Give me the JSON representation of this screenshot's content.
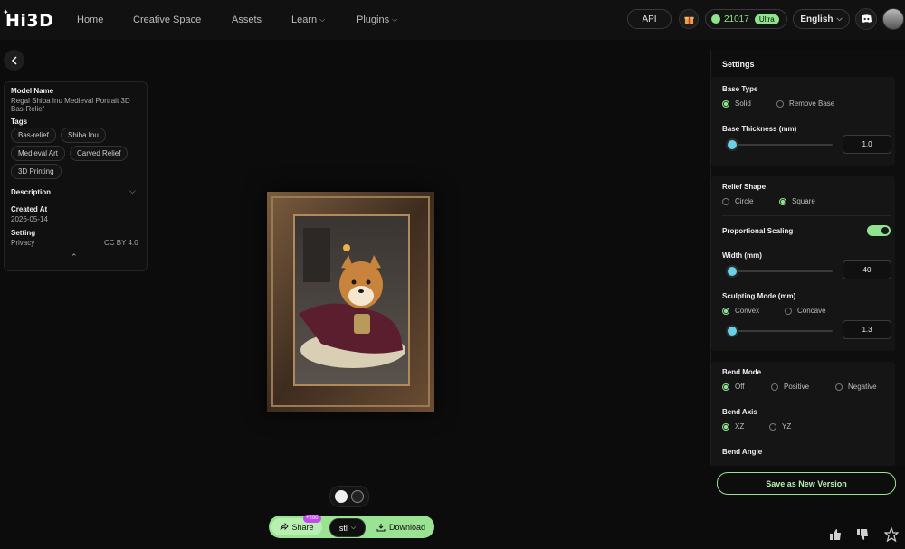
{
  "header": {
    "logo_text": "Hi3D",
    "logo_mark": "✦",
    "nav": [
      {
        "label": "Home"
      },
      {
        "label": "Creative Space"
      },
      {
        "label": "Assets"
      },
      {
        "label": "Learn"
      },
      {
        "label": "Plugins"
      }
    ],
    "api_label": "API",
    "credits": "21017",
    "tier": "Ultra",
    "language": "English"
  },
  "left_panel": {
    "model_name_label": "Model Name",
    "model_name": "Regal Shiba Inu Medieval Portrait 3D Bas-Relief",
    "tags_label": "Tags",
    "tags": [
      "Bas-relief",
      "Shiba Inu",
      "Medieval Art",
      "Carved Relief",
      "3D Printing"
    ],
    "description_label": "Description",
    "created_label": "Created At",
    "created_value": "2026-05-14",
    "setting_label": "Setting",
    "privacy_label": "Privacy",
    "privacy_value": "CC BY 4.0"
  },
  "settings": {
    "title": "Settings",
    "base_type": {
      "label": "Base Type",
      "options": [
        "Solid",
        "Remove Base"
      ],
      "selected": "Solid"
    },
    "base_thickness": {
      "label": "Base Thickness (mm)",
      "value": "1.0",
      "fraction": 0.0
    },
    "relief_shape": {
      "label": "Relief Shape",
      "options": [
        "Circle",
        "Square"
      ],
      "selected": "Square"
    },
    "proportional_scaling": {
      "label": "Proportional Scaling",
      "on": true
    },
    "width": {
      "label": "Width (mm)",
      "value": "40",
      "fraction": 0.0
    },
    "sculpting_mode": {
      "label": "Sculpting Mode (mm)",
      "options": [
        "Convex",
        "Concave"
      ],
      "selected": "Convex",
      "value": "1.3",
      "fraction": 0.0
    },
    "bend_mode": {
      "label": "Bend Mode",
      "options": [
        "Off",
        "Positive",
        "Negative"
      ],
      "selected": "Off"
    },
    "bend_axis": {
      "label": "Bend Axis",
      "options": [
        "XZ",
        "YZ"
      ],
      "selected": "XZ"
    },
    "bend_angle": {
      "label": "Bend Angle"
    },
    "save_label": "Save as New Version"
  },
  "bottom": {
    "share_label": "Share",
    "share_badge": "+200",
    "format": "stl",
    "download_label": "Download"
  },
  "colors": {
    "accent": "#8fe38c",
    "slider_knob": "#6ad0e3",
    "badge": "#c04cf0"
  }
}
